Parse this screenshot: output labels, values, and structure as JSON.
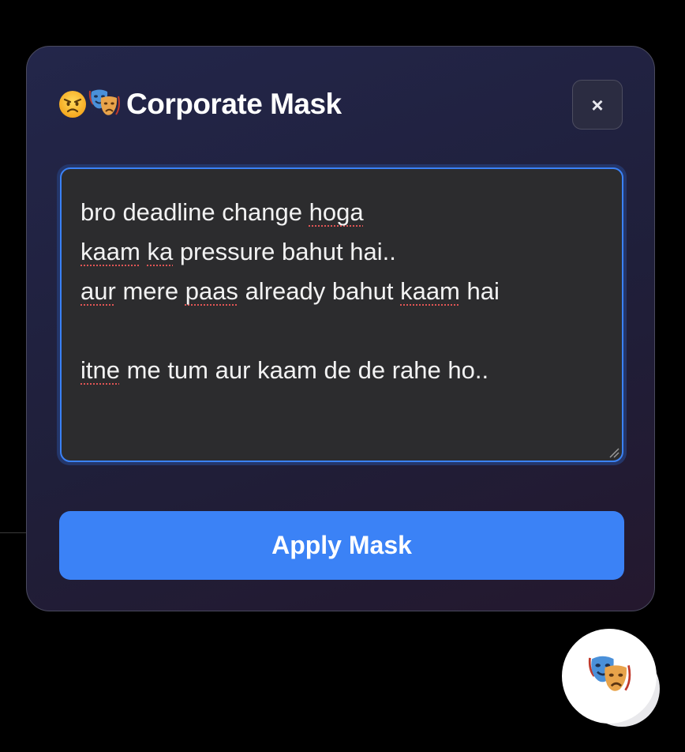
{
  "modal": {
    "title": "Corporate Mask",
    "title_icons": [
      "angry-face-icon",
      "performing-arts-icon"
    ],
    "close_label": "×",
    "input": {
      "lines": [
        "bro deadline change hoga",
        "kaam ka pressure bahut hai..",
        "aur mere paas already bahut kaam hai",
        "",
        "itne me tum aur kaam de de rahe ho.."
      ]
    },
    "apply_label": "Apply Mask"
  },
  "fab": {
    "icon": "performing-arts-icon"
  },
  "colors": {
    "accent": "#3b82f6",
    "panel_border": "#4a4a5e",
    "textarea_bg": "#2c2c2e",
    "spellcheck": "#e05555"
  }
}
